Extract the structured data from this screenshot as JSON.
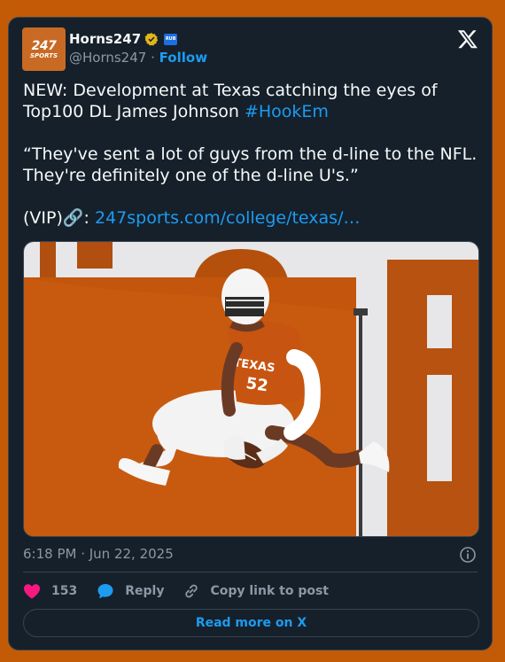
{
  "account": {
    "name": "Horns247",
    "handle": "@Horns247",
    "separator": "·",
    "follow_label": "Follow",
    "avatar_text_big": "247",
    "avatar_text_small": "SPORTS",
    "affiliate_badge_text": "RUB"
  },
  "tweet": {
    "line1_text": "NEW: Development at Texas catching the eyes of Top100 DL James Johnson ",
    "hashtag": "#HookEm",
    "quote": "“They've sent a lot of guys from the d-line to the NFL. They're definitely one of the d-line U's.”",
    "vip_prefix": "(VIP)🔗: ",
    "link": "247sports.com/college/texas/…"
  },
  "media": {
    "icon": "photo-football-player",
    "jersey_text": "TEXAS",
    "jersey_number": "52"
  },
  "meta": {
    "timestamp": "6:18 PM · Jun 22, 2025"
  },
  "actions": {
    "like_count": "153",
    "reply_label": "Reply",
    "copy_label": "Copy link to post"
  },
  "footer": {
    "read_more_label": "Read more on X"
  },
  "colors": {
    "page_background": "#c35b06",
    "card_background": "#15202b",
    "accent": "#1d9bf0",
    "like": "#f91880",
    "texas_orange": "#bf5700"
  }
}
